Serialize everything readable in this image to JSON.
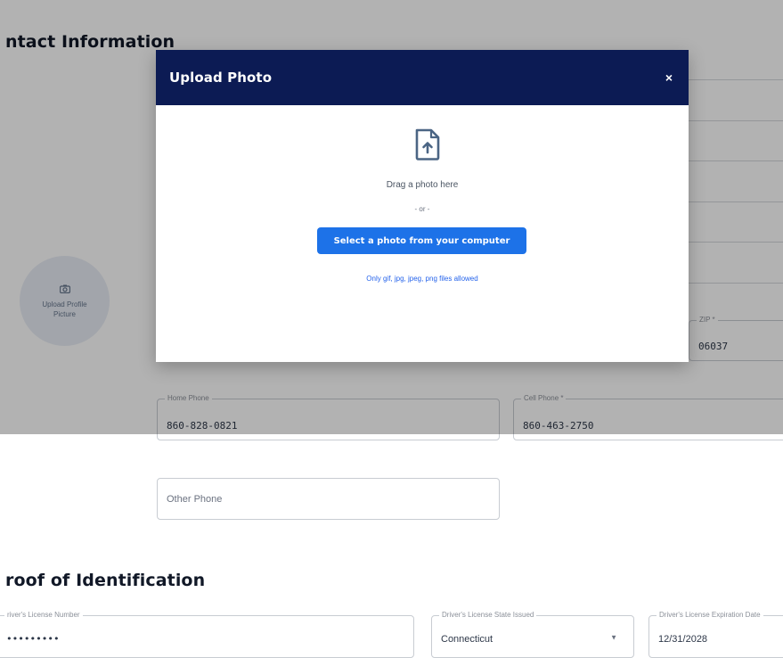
{
  "sections": {
    "contact_title": "ntact Information",
    "proof_title": "roof of Identification"
  },
  "avatar": {
    "label": "Upload Profile Picture"
  },
  "fields": {
    "zip": {
      "label": "ZIP *",
      "value": "06037"
    },
    "home_phone": {
      "label": "Home Phone",
      "value": "860-828-0821"
    },
    "cell_phone": {
      "label": "Cell Phone *",
      "value": "860-463-2750"
    },
    "other_phone": {
      "placeholder": "Other Phone"
    },
    "license_number": {
      "label": "river's License Number",
      "value": "•••••••••"
    },
    "license_state": {
      "label": "Driver's License State Issued",
      "value": "Connecticut"
    },
    "license_expiration": {
      "label": "Driver's License Expiration Date",
      "value": "12/31/2028"
    }
  },
  "modal": {
    "title": "Upload Photo",
    "close": "×",
    "drag_text": "Drag a photo here",
    "or_text": "- or -",
    "select_button": "Select a photo from your computer",
    "hint": "Only gif, jpg, jpeg, png files allowed"
  },
  "icons": {
    "upload": "file-upload-icon",
    "camera": "camera-icon",
    "close": "close-icon",
    "dropdown": "chevron-down-icon"
  },
  "colors": {
    "modal_header": "#0c1b54",
    "primary_button": "#1d72e8",
    "overlay": "rgba(0,0,0,0.30)"
  }
}
